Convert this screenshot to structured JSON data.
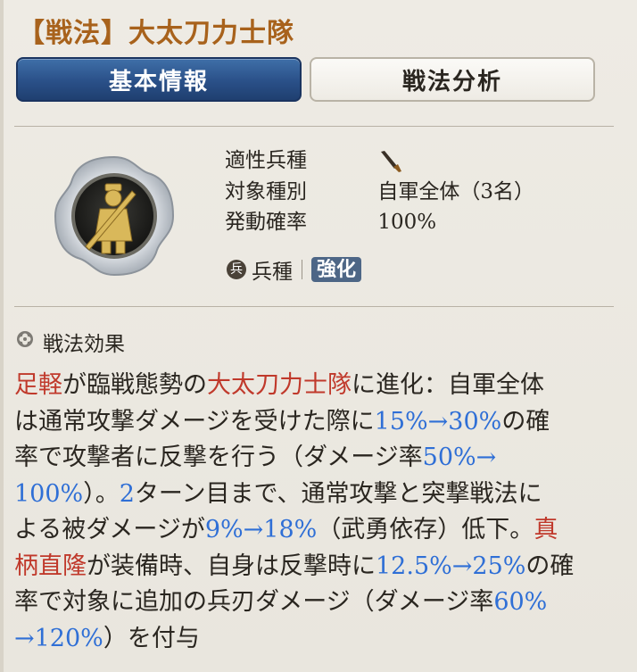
{
  "title": "【戦法】大太刀力士隊",
  "tabs": [
    {
      "label": "基本情報",
      "active": true
    },
    {
      "label": "戦法分析",
      "active": false
    }
  ],
  "info": {
    "unit_type_label": "適性兵種",
    "unit_type_icon": "sword-icon",
    "target_label": "対象種別",
    "target_value": "自軍全体（3名）",
    "rate_label": "発動確率",
    "rate_value": "100%"
  },
  "tags": {
    "circle_glyph": "兵",
    "type_label": "兵種",
    "badge_label": "強化"
  },
  "section": {
    "icon": "clover-icon",
    "title": "戦法効果"
  },
  "effect_lines": [
    [
      {
        "t": "足軽",
        "c": "red"
      },
      {
        "t": "が臨戦態勢の",
        "c": ""
      },
      {
        "t": "大太刀力士隊",
        "c": "red"
      },
      {
        "t": "に進化：自軍全体",
        "c": ""
      }
    ],
    [
      {
        "t": "は通常攻撃ダメージを受けた際に",
        "c": ""
      },
      {
        "t": "15%→30%",
        "c": "blue"
      },
      {
        "t": "の確",
        "c": ""
      }
    ],
    [
      {
        "t": "率で攻撃者に反撃を行う（ダメージ率",
        "c": ""
      },
      {
        "t": "50%→",
        "c": "blue"
      }
    ],
    [
      {
        "t": "100%",
        "c": "blue"
      },
      {
        "t": "）。",
        "c": ""
      },
      {
        "t": "2",
        "c": "blue"
      },
      {
        "t": "ターン目まで、通常攻撃と突撃戦法に",
        "c": ""
      }
    ],
    [
      {
        "t": "よる被ダメージが",
        "c": ""
      },
      {
        "t": "9%→18%",
        "c": "blue"
      },
      {
        "t": "（武勇依存）低下。",
        "c": ""
      },
      {
        "t": "真",
        "c": "red"
      }
    ],
    [
      {
        "t": "柄直隆",
        "c": "red"
      },
      {
        "t": "が装備時、自身は反撃時に",
        "c": ""
      },
      {
        "t": "12.5%→25%",
        "c": "blue"
      },
      {
        "t": "の確",
        "c": ""
      }
    ],
    [
      {
        "t": "率で対象に追加の兵刃ダメージ（ダメージ率",
        "c": ""
      },
      {
        "t": "60%",
        "c": "blue"
      }
    ],
    [
      {
        "t": "→120%",
        "c": "blue"
      },
      {
        "t": "）を付与",
        "c": ""
      }
    ]
  ],
  "colors": {
    "title": "#a8621c",
    "highlight_red": "#c0392b",
    "highlight_blue": "#2f6fd6",
    "tab_active": "#2a5088"
  }
}
